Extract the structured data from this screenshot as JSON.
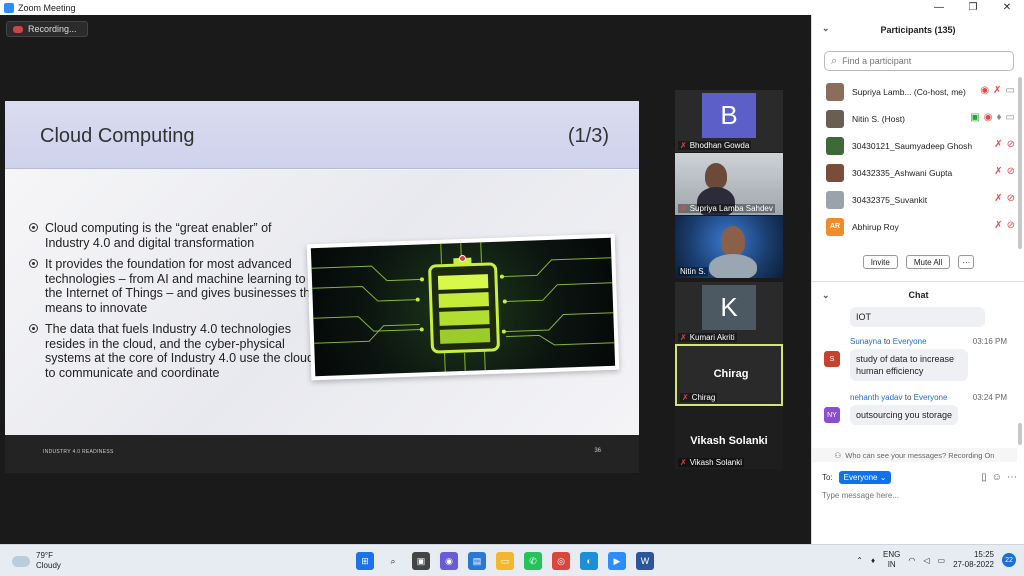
{
  "window": {
    "title": "Zoom Meeting",
    "controls": [
      "—",
      "❐",
      "✕"
    ]
  },
  "recording": {
    "label": "Recording..."
  },
  "slide": {
    "title": "Cloud Computing",
    "page": "(1/3)",
    "bullets": [
      "Cloud computing is the “great enabler” of Industry 4.0 and digital transformation",
      "It provides the foundation for most advanced technologies – from AI and machine learning to the Internet of Things – and gives businesses the means to innovate",
      "The data that fuels Industry 4.0 technologies resides in the cloud, and the cyber-physical systems at the core of Industry 4.0 use the cloud to communicate and coordinate"
    ],
    "footer_left": "INDUSTRY 4.0 READINESS",
    "footer_right": "36"
  },
  "gallery": [
    {
      "name": "Bhodhan Gowda",
      "initial": "B",
      "color": "#5b5fc7"
    },
    {
      "name": "Supriya Lamba  Sahdev"
    },
    {
      "name": "Nitin S."
    },
    {
      "name": "Kumari Akriti",
      "initial": "K",
      "color": "#4c5862"
    },
    {
      "name": "Chirag",
      "big": "Chirag"
    },
    {
      "name": "Vikash Solanki",
      "big": "Vikash Solanki"
    }
  ],
  "participants": {
    "header": "Participants (135)",
    "search_placeholder": "Find a participant",
    "list": [
      {
        "name": "Supriya Lamb...  (Co-host, me)",
        "avatar_color": "#8a6d5a",
        "initials": ""
      },
      {
        "name": "Nitin S. (Host)",
        "avatar_color": "#6a5d52",
        "initials": ""
      },
      {
        "name": "30430121_Saumyadeep Ghosh",
        "avatar_color": "#3e6a3a",
        "initials": ""
      },
      {
        "name": "30432335_Ashwani Gupta",
        "avatar_color": "#7a4d3a",
        "initials": ""
      },
      {
        "name": "30432375_Suvankit",
        "avatar_color": "#9aa3ab",
        "initials": ""
      },
      {
        "name": "Abhirup Roy",
        "avatar_color": "#f08c2a",
        "initials": "AR"
      }
    ],
    "invite": "Invite",
    "mute_all": "Mute All",
    "more": "···"
  },
  "chat": {
    "header": "Chat",
    "messages": [
      {
        "text": "IOT"
      },
      {
        "sender": "Sunayna",
        "to_word": "to",
        "recipient": "Everyone",
        "time": "03:16 PM",
        "initials": "S",
        "color": "#c8412f",
        "text": "study of data to increase human efficiency"
      },
      {
        "sender": "nehanth yadav",
        "to_word": "to",
        "recipient": "Everyone",
        "time": "03:24 PM",
        "initials": "NY",
        "color": "#8a4fd1",
        "text": "outsourcing you storage"
      }
    ],
    "who_can_see": "Who can see your messages? Recording On",
    "to_label": "To:",
    "to_value": "Everyone ⌄",
    "input_placeholder": "Type message here..."
  },
  "taskbar": {
    "temperature": "79°F",
    "weather": "Cloudy",
    "lang_top": "ENG",
    "lang_bottom": "IN",
    "time": "15:25",
    "date": "27-08-2022",
    "notifications": "22"
  }
}
